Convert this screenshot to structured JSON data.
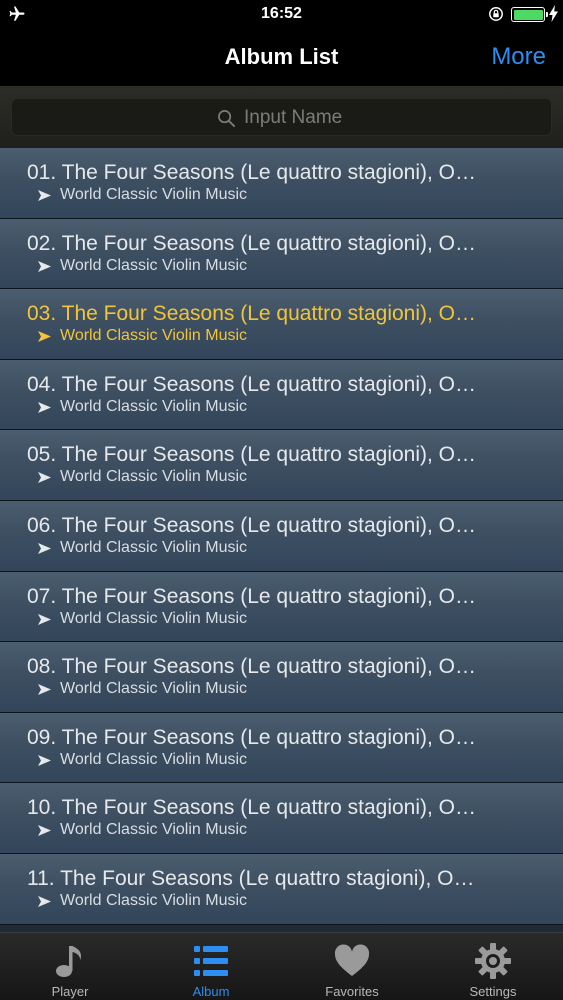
{
  "status_bar": {
    "time": "16:52",
    "icons": [
      "airplane-icon",
      "rotation-lock-icon",
      "battery-icon",
      "charging-bolt-icon"
    ],
    "battery_color": "#4cd964"
  },
  "nav_bar": {
    "title": "Album List",
    "more_label": "More",
    "accent_color": "#2d8df0"
  },
  "search": {
    "placeholder": "Input Name",
    "value": ""
  },
  "tracks": [
    {
      "title": "01. The Four Seasons (Le quattro stagioni), O…",
      "artist": "World Classic Violin Music",
      "active": false
    },
    {
      "title": "02. The Four Seasons (Le quattro stagioni), O…",
      "artist": "World Classic Violin Music",
      "active": false
    },
    {
      "title": "03. The Four Seasons (Le quattro stagioni), O…",
      "artist": "World Classic Violin Music",
      "active": true
    },
    {
      "title": "04. The Four Seasons (Le quattro stagioni), O…",
      "artist": "World Classic Violin Music",
      "active": false
    },
    {
      "title": "05. The Four Seasons (Le quattro stagioni), O…",
      "artist": "World Classic Violin Music",
      "active": false
    },
    {
      "title": "06. The Four Seasons (Le quattro stagioni), O…",
      "artist": "World Classic Violin Music",
      "active": false
    },
    {
      "title": "07. The Four Seasons (Le quattro stagioni), O…",
      "artist": "World Classic Violin Music",
      "active": false
    },
    {
      "title": "08. The Four Seasons (Le quattro stagioni), O…",
      "artist": "World Classic Violin Music",
      "active": false
    },
    {
      "title": "09. The Four Seasons (Le quattro stagioni), O…",
      "artist": "World Classic Violin Music",
      "active": false
    },
    {
      "title": "10. The Four Seasons (Le quattro stagioni), O…",
      "artist": "World Classic Violin Music",
      "active": false
    },
    {
      "title": "11. The Four Seasons (Le quattro stagioni), O…",
      "artist": "World Classic Violin Music",
      "active": false
    }
  ],
  "active_color": "#f2c43a",
  "tab_bar": {
    "tabs": [
      {
        "label": "Player",
        "icon": "music-note-icon",
        "active": false
      },
      {
        "label": "Album",
        "icon": "list-icon",
        "active": true
      },
      {
        "label": "Favorites",
        "icon": "heart-icon",
        "active": false
      },
      {
        "label": "Settings",
        "icon": "gear-icon",
        "active": false
      }
    ]
  }
}
